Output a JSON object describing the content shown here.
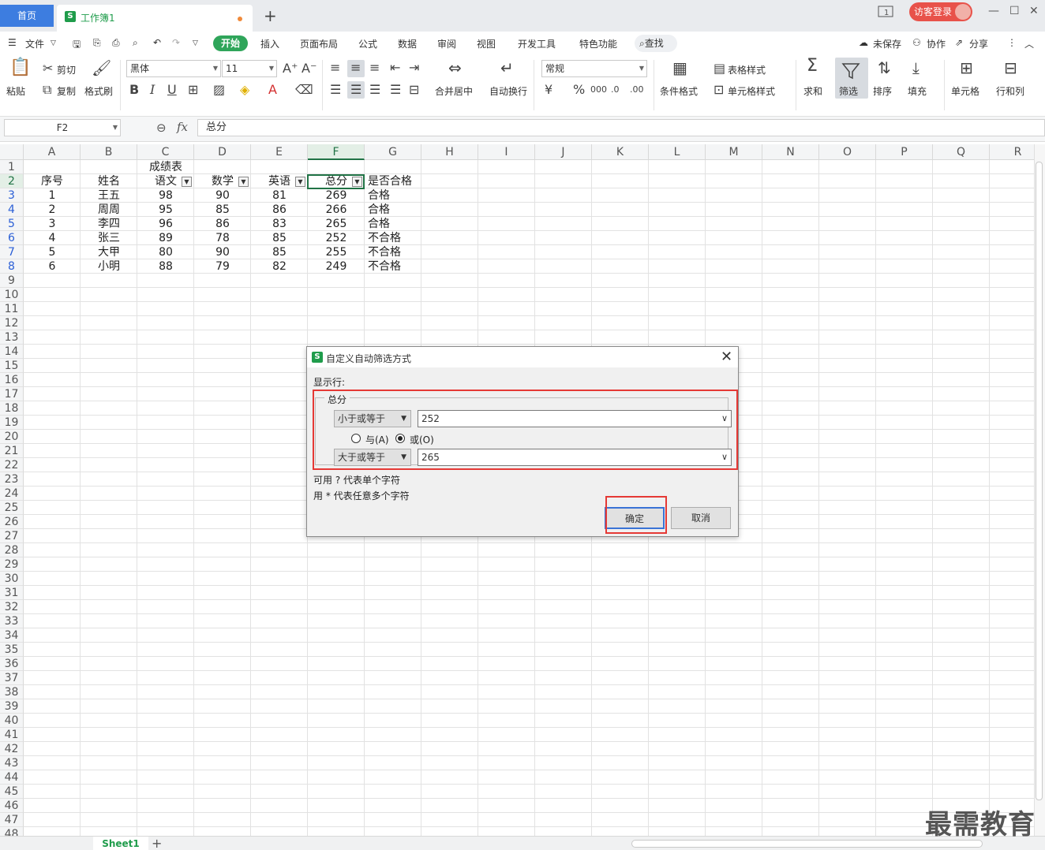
{
  "titlebar": {
    "home_tab": "首页",
    "doc_tab": "工作簿1",
    "visitor_login": "访客登录"
  },
  "menu": {
    "file": "文件",
    "items": [
      "开始",
      "插入",
      "页面布局",
      "公式",
      "数据",
      "审阅",
      "视图",
      "开发工具",
      "特色功能"
    ],
    "search": "查找",
    "unsaved": "未保存",
    "collab": "协作",
    "share": "分享"
  },
  "ribbon": {
    "paste": "粘贴",
    "cut": "剪切",
    "copy": "复制",
    "format_painter": "格式刷",
    "font_name": "黑体",
    "font_size": "11",
    "number_format": "常规",
    "merge_center": "合并居中",
    "wrap_text": "自动换行",
    "cond_format": "条件格式",
    "table_style": "表格样式",
    "cell_style": "单元格样式",
    "sum": "求和",
    "filter": "筛选",
    "sort": "排序",
    "fill": "填充",
    "cell": "单元格",
    "row_col": "行和列"
  },
  "formula_bar": {
    "name_box": "F2",
    "fx": "fx",
    "formula": "总分"
  },
  "sheet": {
    "columns": [
      "A",
      "B",
      "C",
      "D",
      "E",
      "F",
      "G",
      "H",
      "I",
      "J",
      "K",
      "L",
      "M",
      "N",
      "O",
      "P",
      "Q",
      "R"
    ],
    "row_numbers": [
      "1",
      "2",
      "3",
      "4",
      "5",
      "6",
      "7",
      "8",
      "9",
      "10",
      "11",
      "12",
      "13",
      "14",
      "15",
      "16",
      "17",
      "18",
      "19",
      "20",
      "21",
      "22",
      "23",
      "24",
      "25",
      "26",
      "27",
      "28",
      "29",
      "30",
      "31",
      "32",
      "33",
      "34",
      "35",
      "36",
      "37",
      "38",
      "39",
      "40",
      "41",
      "42",
      "43",
      "44",
      "45",
      "46",
      "47",
      "48"
    ],
    "title": "成绩表",
    "headers": [
      "序号",
      "姓名",
      "语文",
      "数学",
      "英语",
      "总分",
      "是否合格"
    ],
    "rows": [
      [
        "1",
        "王五",
        "98",
        "90",
        "81",
        "269",
        "合格"
      ],
      [
        "2",
        "周周",
        "95",
        "85",
        "86",
        "266",
        "合格"
      ],
      [
        "3",
        "李四",
        "96",
        "86",
        "83",
        "265",
        "合格"
      ],
      [
        "4",
        "张三",
        "89",
        "78",
        "85",
        "252",
        "不合格"
      ],
      [
        "5",
        "大甲",
        "80",
        "90",
        "85",
        "255",
        "不合格"
      ],
      [
        "6",
        "小明",
        "88",
        "79",
        "82",
        "249",
        "不合格"
      ]
    ],
    "sheet_tab": "Sheet1"
  },
  "dialog": {
    "title": "自定义自动筛选方式",
    "show_rows": "显示行:",
    "field": "总分",
    "op1": "小于或等于",
    "val1": "252",
    "and_label": "与(A)",
    "or_label": "或(O)",
    "op2": "大于或等于",
    "val2": "265",
    "hint1": "可用 ? 代表单个字符",
    "hint2": "用 * 代表任意多个字符",
    "ok": "确定",
    "cancel": "取消"
  },
  "watermark": "最需教育"
}
